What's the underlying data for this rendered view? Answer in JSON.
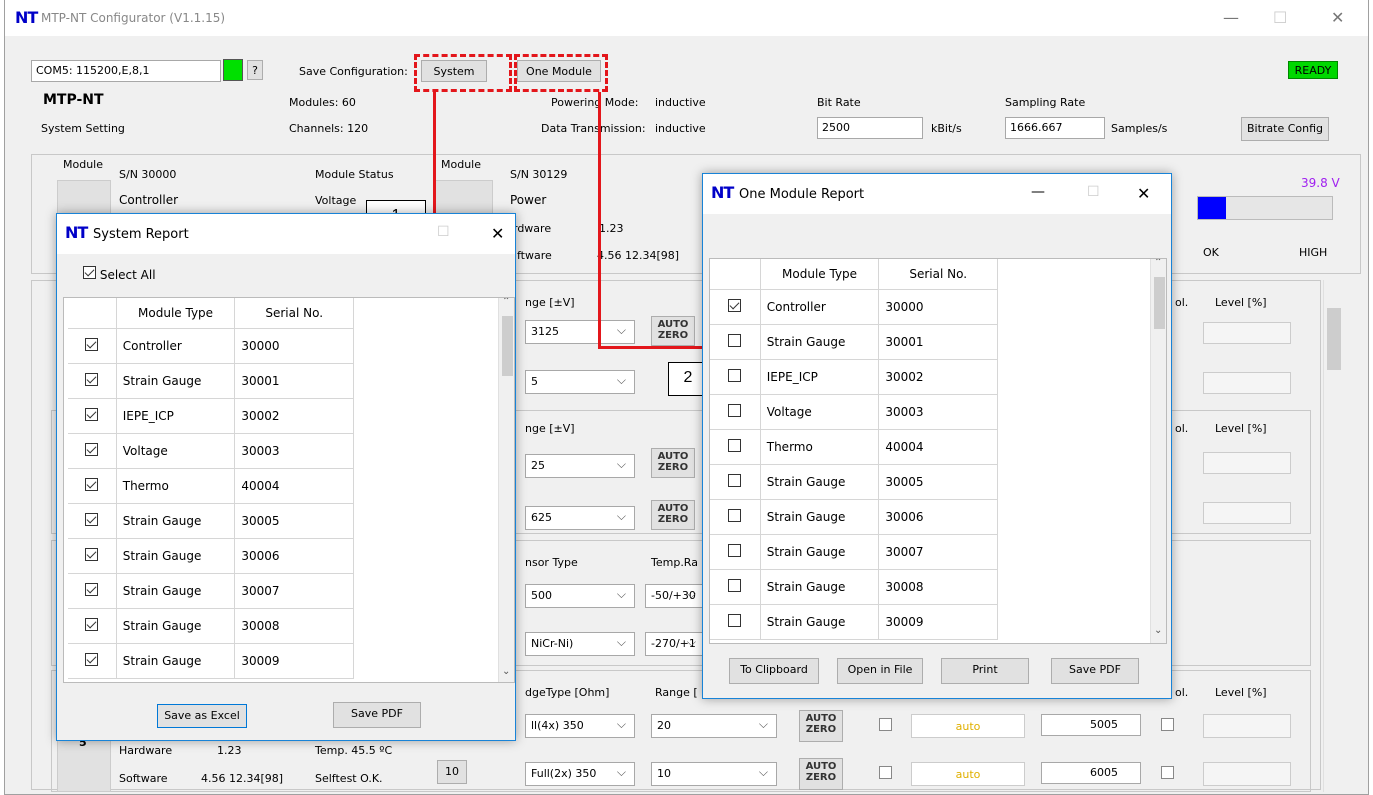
{
  "app": {
    "title": "MTP-NT Configurator (V1.1.15)",
    "logo": "NT",
    "controls": {
      "minimize": "—",
      "maximize": "☐",
      "close": "✕"
    }
  },
  "top": {
    "com": "COM5: 115200,E,8,1",
    "help": "?",
    "save_label": "Save Configuration:",
    "system_btn": "System",
    "one_module_btn": "One Module",
    "ready": "READY",
    "device": "MTP-NT",
    "system_setting": "System Setting",
    "modules": "Modules: 60",
    "channels": "Channels: 120",
    "powering": "Powering Mode:",
    "powering_val": "inductive",
    "data_tx": "Data Transmission:",
    "data_tx_val": "inductive",
    "bitrate_lbl": "Bit Rate",
    "bitrate_val": "2500",
    "bitrate_unit": "kBit/s",
    "sampling_lbl": "Sampling Rate",
    "sampling_val": "1666.667",
    "sampling_unit": "Samples/s",
    "bitrate_config": "Bitrate Config"
  },
  "modules": {
    "module": "Module",
    "sn1": "S/N 30000",
    "controller": "Controller",
    "status": "Module Status",
    "voltage": "Voltage",
    "sn2": "S/N 30129",
    "power": "Power",
    "hardware_lbl": "rdware",
    "hardware_val": "1.23",
    "software_lbl": "ftware",
    "software_val": "4.56  12.34[98]",
    "module_status2": "Module Status",
    "volt": "39.8  V",
    "ok": "OK",
    "high": "HIGH"
  },
  "channels": {
    "range": "nge [±V]",
    "range2": "nge [±V]",
    "v1": "3125",
    "v2": "5",
    "v3": "25",
    "v4": "625",
    "auto": "AUTO",
    "zero": "ZERO",
    "sensor_type": "nsor Type",
    "temp_ra": "Temp.Ra",
    "s1": "500",
    "t1": "-50/+30",
    "s2": "NiCr-Ni)",
    "t2": "-270/+1",
    "pol": "ol.",
    "level": "Level  [%]",
    "bridge": "dgeType  [Ohm]",
    "range_b": "Range  [",
    "b1": "ll(4x) 350",
    "r1": "20",
    "b2": "Full(2x) 350",
    "r2": "10",
    "auto_val": "auto",
    "n1": "5005",
    "n2": "6005",
    "hardware": "Hardware",
    "hw_val": "1.23",
    "temp": "Temp.  45.5 ºC",
    "software": "Software",
    "sw_val": "4.56  12.34[98]",
    "selftest": "Selftest O.K.",
    "mod_num": "10",
    "five": "5"
  },
  "callouts": {
    "c1": "1",
    "c2": "2"
  },
  "system_report": {
    "title": "System Report",
    "select_all": "Select All",
    "col_type": "Module Type",
    "col_serial": "Serial No.",
    "save_excel": "Save as Excel",
    "save_pdf": "Save PDF",
    "rows": [
      {
        "type": "Controller",
        "serial": "30000",
        "checked": true
      },
      {
        "type": "Strain Gauge",
        "serial": "30001",
        "checked": true
      },
      {
        "type": "IEPE_ICP",
        "serial": "30002",
        "checked": true
      },
      {
        "type": "Voltage",
        "serial": "30003",
        "checked": true
      },
      {
        "type": "Thermo",
        "serial": "40004",
        "checked": true
      },
      {
        "type": "Strain Gauge",
        "serial": "30005",
        "checked": true
      },
      {
        "type": "Strain Gauge",
        "serial": "30006",
        "checked": true
      },
      {
        "type": "Strain Gauge",
        "serial": "30007",
        "checked": true
      },
      {
        "type": "Strain Gauge",
        "serial": "30008",
        "checked": true
      },
      {
        "type": "Strain Gauge",
        "serial": "30009",
        "checked": true
      }
    ]
  },
  "one_module_report": {
    "title": "One Module Report",
    "col_type": "Module Type",
    "col_serial": "Serial No.",
    "to_clipboard": "To Clipboard",
    "open_in_file": "Open in File",
    "print": "Print",
    "save_pdf": "Save PDF",
    "rows": [
      {
        "type": "Controller",
        "serial": "30000",
        "checked": true
      },
      {
        "type": "Strain Gauge",
        "serial": "30001",
        "checked": false
      },
      {
        "type": "IEPE_ICP",
        "serial": "30002",
        "checked": false
      },
      {
        "type": "Voltage",
        "serial": "30003",
        "checked": false
      },
      {
        "type": "Thermo",
        "serial": "40004",
        "checked": false
      },
      {
        "type": "Strain Gauge",
        "serial": "30005",
        "checked": false
      },
      {
        "type": "Strain Gauge",
        "serial": "30006",
        "checked": false
      },
      {
        "type": "Strain Gauge",
        "serial": "30007",
        "checked": false
      },
      {
        "type": "Strain Gauge",
        "serial": "30008",
        "checked": false
      },
      {
        "type": "Strain Gauge",
        "serial": "30009",
        "checked": false
      }
    ]
  },
  "colors": {
    "accent_red": "#e3161b",
    "ready_green": "#00cc00",
    "bar_blue": "#0000ff",
    "volt_purple": "#a020f0"
  }
}
